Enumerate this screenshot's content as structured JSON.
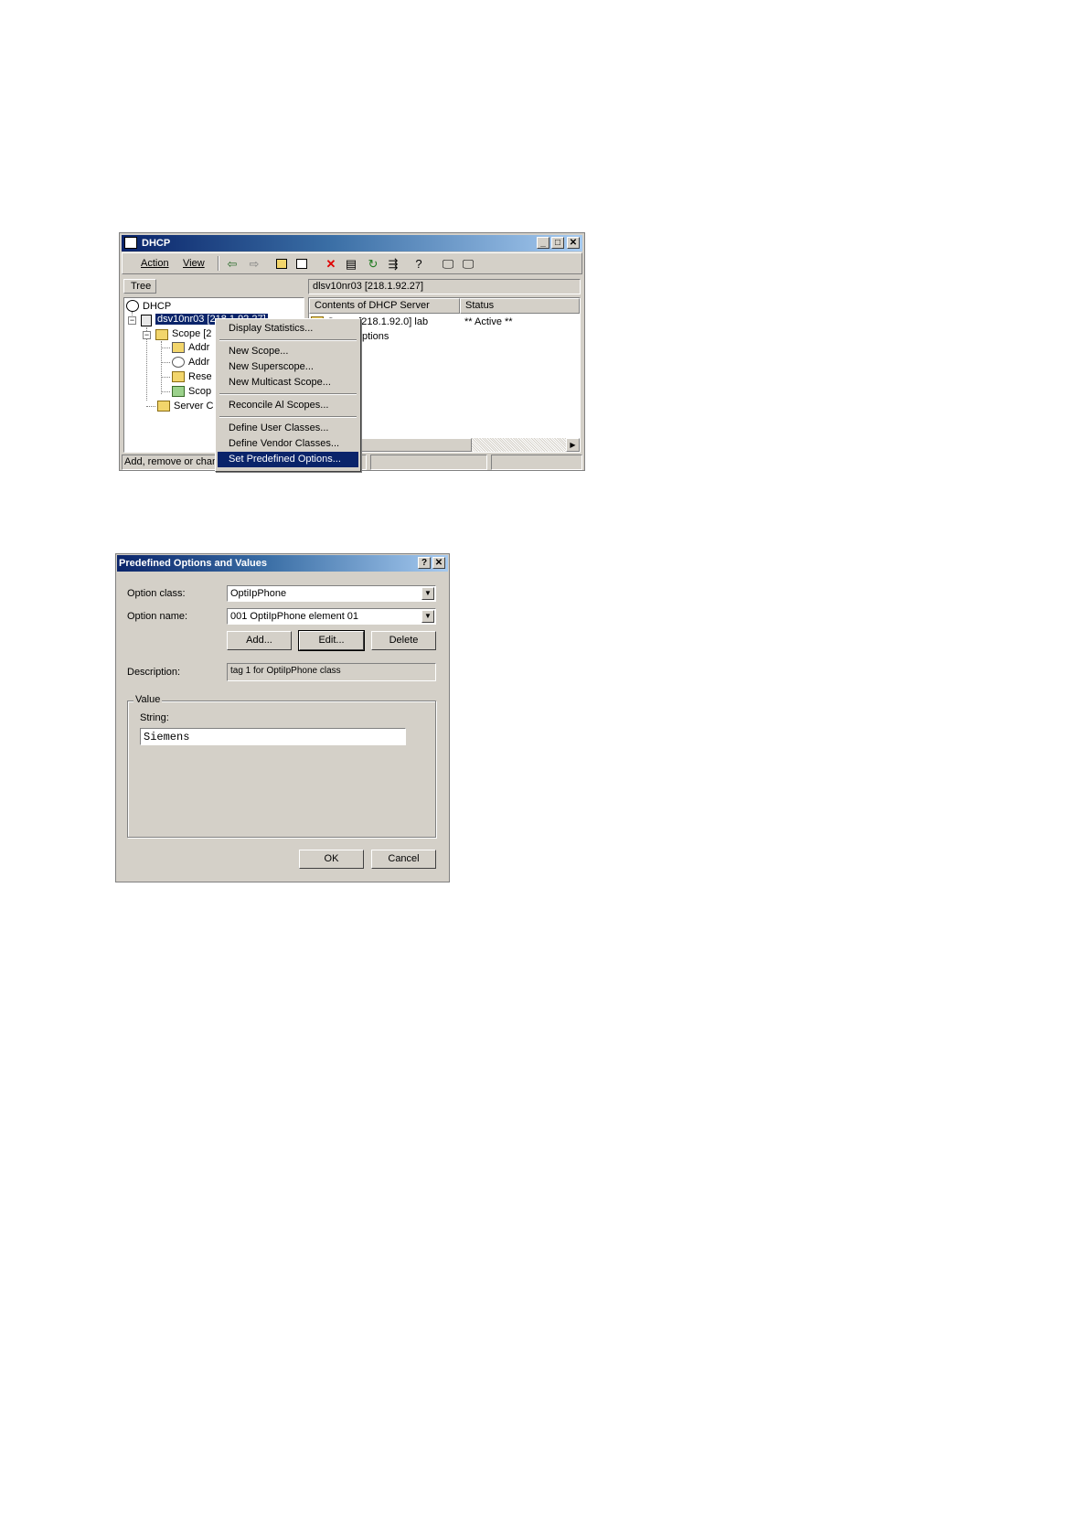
{
  "dhcp_window": {
    "title": "DHCP",
    "menu": {
      "action": "Action",
      "view": "View"
    },
    "tree_tab": "Tree",
    "tree": {
      "root": "DHCP",
      "server": "dsv10nr03 [218.1.92.27]",
      "scope": "Scope [2",
      "children": [
        "Addr",
        "Addr",
        "Rese",
        "Scop"
      ],
      "server_options": "Server C"
    },
    "right_header": "dlsv10nr03 [218.1.92.27]",
    "columns": {
      "contents": "Contents of DHCP Server",
      "status": "Status"
    },
    "rows": [
      {
        "name": "Scope [218.1.92.0] lab",
        "status": "** Active **"
      },
      {
        "name": "ptions",
        "status": ""
      }
    ],
    "status_bar": "Add, remove or chan",
    "context_menu": {
      "items": [
        "Display Statistics...",
        "New Scope...",
        "New Superscope...",
        "New Multicast Scope...",
        "Reconcile Al Scopes...",
        "Define User Classes...",
        "Define Vendor Classes...",
        "Set Predefined Options..."
      ]
    }
  },
  "dialog": {
    "title": "Predefined Options and Values",
    "option_class_label": "Option class:",
    "option_class_value": "OptiIpPhone",
    "option_name_label": "Option name:",
    "option_name_value": "001 OptiIpPhone element 01",
    "add_label": "Add...",
    "edit_label": "Edit...",
    "delete_label": "Delete",
    "description_label": "Description:",
    "description_value": "tag 1 for OptiIpPhone class",
    "value_group": "Value",
    "string_label": "String:",
    "string_value": "Siemens",
    "ok_label": "OK",
    "cancel_label": "Cancel"
  },
  "colors": {
    "face": "#d4d0c8",
    "highlight": "#0a246a",
    "title_start": "#0a246a",
    "title_end": "#a6caf0"
  }
}
